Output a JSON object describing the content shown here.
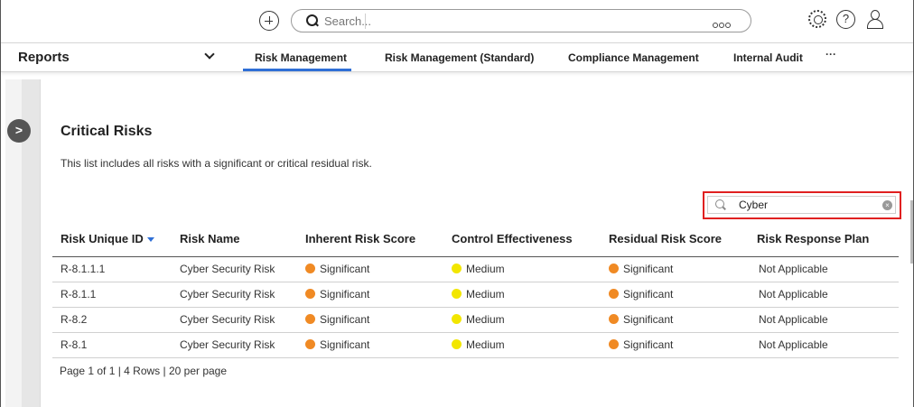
{
  "topbar": {
    "search_placeholder": "Search...",
    "icons": [
      "add-icon",
      "search-icon",
      "more-options-icon",
      "gear-icon",
      "help-icon",
      "user-icon"
    ],
    "help_glyph": "?"
  },
  "nav": {
    "reports_label": "Reports",
    "tabs": [
      {
        "label": "Risk Management",
        "active": true
      },
      {
        "label": "Risk Management (Standard)",
        "active": false
      },
      {
        "label": "Compliance Management",
        "active": false
      },
      {
        "label": "Internal Audit",
        "active": false
      }
    ],
    "more_label": "···",
    "accent_color": "#2f6fd6"
  },
  "sidebar": {
    "expand_glyph": ">"
  },
  "report": {
    "title": "Critical Risks",
    "description": "This list includes all risks with a significant or critical residual risk.",
    "filter_value": "Cyber",
    "filter_highlight_color": "#e02020"
  },
  "table": {
    "columns": [
      "Risk Unique ID",
      "Risk Name",
      "Inherent Risk Score",
      "Control Effectiveness",
      "Residual Risk Score",
      "Risk Response Plan"
    ],
    "sort_column": "Risk Unique ID",
    "rows": [
      {
        "id": "R-8.1.1.1",
        "name": "Cyber Security Risk",
        "inherent": "Significant",
        "control": "Medium",
        "residual": "Significant",
        "plan": "Not Applicable"
      },
      {
        "id": "R-8.1.1",
        "name": "Cyber Security Risk",
        "inherent": "Significant",
        "control": "Medium",
        "residual": "Significant",
        "plan": "Not Applicable"
      },
      {
        "id": "R-8.2",
        "name": "Cyber Security Risk",
        "inherent": "Significant",
        "control": "Medium",
        "residual": "Significant",
        "plan": "Not Applicable"
      },
      {
        "id": "R-8.1",
        "name": "Cyber Security Risk",
        "inherent": "Significant",
        "control": "Medium",
        "residual": "Significant",
        "plan": "Not Applicable"
      }
    ],
    "status_colors": {
      "Significant": "#f08a24",
      "Medium": "#f2e600"
    }
  },
  "pager": {
    "text": "Page 1 of 1 | 4 Rows | 20 per page"
  }
}
